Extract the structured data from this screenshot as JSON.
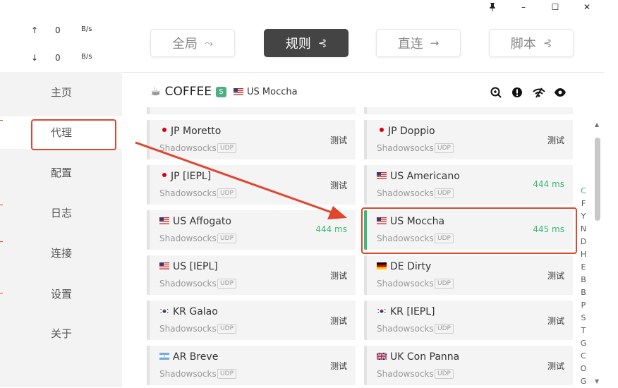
{
  "window": {
    "pin_icon": "pin-icon",
    "minimize_glyph": "–",
    "maximize_glyph": "☐",
    "close_glyph": "✕"
  },
  "speed": {
    "up_arrow": "↑",
    "up_value": "0",
    "up_unit": "B/s",
    "down_arrow": "↓",
    "down_value": "0",
    "down_unit": "B/s"
  },
  "nav": {
    "home": "主页",
    "proxy": "代理",
    "profiles": "配置",
    "logs": "日志",
    "connections": "连接",
    "settings": "设置",
    "about": "关于"
  },
  "modes": {
    "global": "全局",
    "rule": "规则",
    "direct": "直连",
    "script": "脚本"
  },
  "group": {
    "emoji": "☕",
    "name": "COFFEE",
    "badge": "S",
    "selected_node": "US Moccha",
    "icons": [
      "latency-test-icon",
      "alert-icon",
      "wifi-icon",
      "eye-icon"
    ]
  },
  "proxies": [
    {
      "name": "JP Moretto",
      "flag": "jp",
      "type": "Shadowsocks",
      "udp": "UDP",
      "delay": "测试",
      "status": "untested"
    },
    {
      "name": "JP Doppio",
      "flag": "jp",
      "type": "Shadowsocks",
      "udp": "UDP",
      "delay": "测试",
      "status": "untested"
    },
    {
      "name": "JP [IEPL]",
      "flag": "jp",
      "type": "Shadowsocks",
      "udp": "UDP",
      "delay": "测试",
      "status": "untested"
    },
    {
      "name": "US Americano",
      "flag": "us",
      "type": "Shadowsocks",
      "udp": "UDP",
      "delay": "444 ms",
      "status": "ok"
    },
    {
      "name": "US Affogato",
      "flag": "us",
      "type": "Shadowsocks",
      "udp": "UDP",
      "delay": "444 ms",
      "status": "ok"
    },
    {
      "name": "US Moccha",
      "flag": "us",
      "type": "Shadowsocks",
      "udp": "UDP",
      "delay": "445 ms",
      "status": "ok"
    },
    {
      "name": "US [IEPL]",
      "flag": "us",
      "type": "Shadowsocks",
      "udp": "UDP",
      "delay": "测试",
      "status": "untested"
    },
    {
      "name": "DE Dirty",
      "flag": "de",
      "type": "Shadowsocks",
      "udp": "UDP",
      "delay": "测试",
      "status": "untested"
    },
    {
      "name": "KR Galao",
      "flag": "kr",
      "type": "Shadowsocks",
      "udp": "UDP",
      "delay": "测试",
      "status": "untested"
    },
    {
      "name": "KR [IEPL]",
      "flag": "kr",
      "type": "Shadowsocks",
      "udp": "UDP",
      "delay": "测试",
      "status": "untested"
    },
    {
      "name": "AR Breve",
      "flag": "ar",
      "type": "Shadowsocks",
      "udp": "UDP",
      "delay": "测试",
      "status": "untested"
    },
    {
      "name": "UK Con Panna",
      "flag": "uk",
      "type": "Shadowsocks",
      "udp": "UDP",
      "delay": "测试",
      "status": "untested"
    }
  ],
  "alphabet_index": [
    "C",
    "F",
    "Y",
    "N",
    "D",
    "H",
    "E",
    "B",
    "B",
    "P",
    "S",
    "T",
    "G",
    "C",
    "O",
    "G"
  ],
  "colors": {
    "accent_green": "#3cb878",
    "annotation_red": "#e0452e",
    "active_mode_bg": "#444444"
  }
}
